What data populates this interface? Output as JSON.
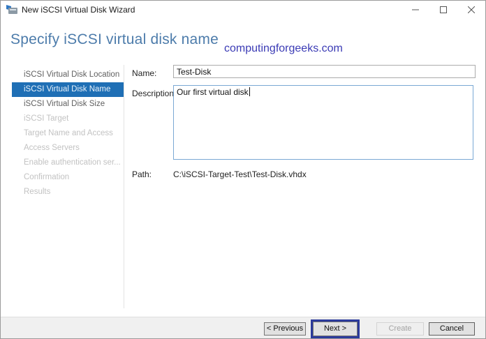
{
  "window": {
    "title": "New iSCSI Virtual Disk Wizard"
  },
  "header": {
    "title": "Specify iSCSI virtual disk name",
    "watermark": "computingforgeeks.com"
  },
  "sidebar": {
    "items": [
      {
        "label": "iSCSI Virtual Disk Location",
        "state": "enabled"
      },
      {
        "label": "iSCSI Virtual Disk Name",
        "state": "selected"
      },
      {
        "label": "iSCSI Virtual Disk Size",
        "state": "enabled"
      },
      {
        "label": "iSCSI Target",
        "state": "disabled"
      },
      {
        "label": "Target Name and Access",
        "state": "disabled"
      },
      {
        "label": "Access Servers",
        "state": "disabled"
      },
      {
        "label": "Enable authentication ser...",
        "state": "disabled"
      },
      {
        "label": "Confirmation",
        "state": "disabled"
      },
      {
        "label": "Results",
        "state": "disabled"
      }
    ]
  },
  "form": {
    "name": {
      "label": "Name:",
      "value": "Test-Disk"
    },
    "description": {
      "label": "Description:",
      "value": "Our first virtual disk"
    },
    "path": {
      "label": "Path:",
      "value": "C:\\iSCSI-Target-Test\\Test-Disk.vhdx"
    }
  },
  "footer": {
    "buttons": {
      "previous": "< Previous",
      "next": "Next >",
      "create": "Create",
      "cancel": "Cancel"
    }
  },
  "icons": {
    "window_icon": "iscsi-wizard-icon",
    "minimize": "minimize-icon",
    "maximize": "maximize-icon",
    "close": "close-icon"
  },
  "colors": {
    "selected_item_bg": "#1f6fb5",
    "header_title": "#4d7cab",
    "watermark": "#3b3bb5",
    "focus_ring": "#2b3a9b",
    "textarea_focus_border": "#7aa8d4",
    "footer_bg": "#f0f0f0"
  }
}
